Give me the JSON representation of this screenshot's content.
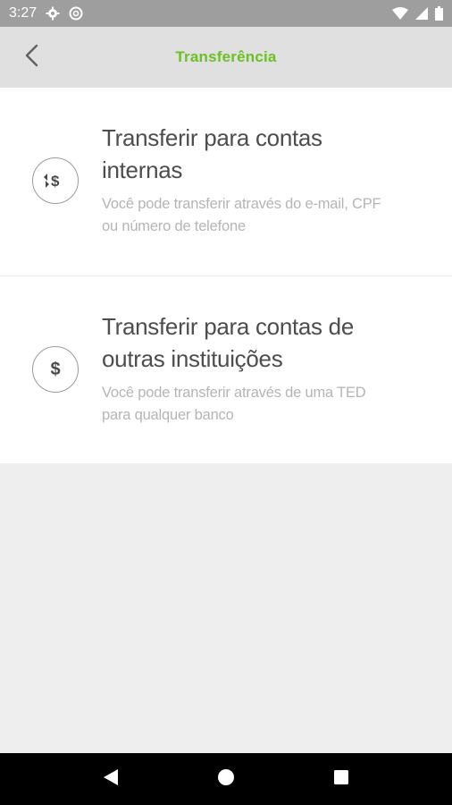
{
  "status_bar": {
    "time": "3:27",
    "icons": [
      "gear-icon",
      "vpn-icon",
      "wifi-icon",
      "signal-icon",
      "battery-icon"
    ]
  },
  "app_bar": {
    "title": "Transferência",
    "back_icon": "chevron-left-icon",
    "title_color": "#6cc024"
  },
  "options": [
    {
      "icon": "internal-transfer-icon",
      "icon_glyph": "⇄$",
      "title_line1": "Transferir para contas",
      "title_line2": "internas",
      "desc_line1": "Você pode transferir através do e-mail, CPF",
      "desc_line2": "ou número de telefone"
    },
    {
      "icon": "dollar-icon",
      "icon_glyph": "$",
      "title_line1": "Transferir para contas de",
      "title_line2": "outras instituições",
      "desc_line1": "Você pode transferir através de uma TED",
      "desc_line2": "para qualquer banco"
    }
  ],
  "nav_bar": {
    "buttons": [
      "back-triangle-icon",
      "home-circle-icon",
      "recents-square-icon"
    ]
  }
}
